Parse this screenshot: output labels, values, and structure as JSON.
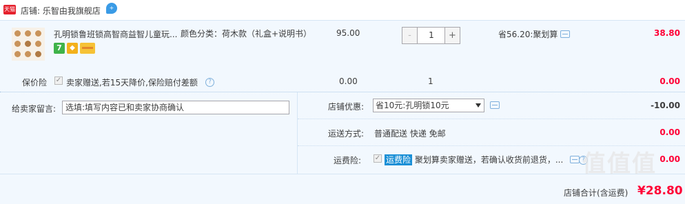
{
  "shop": {
    "badge": "天猫",
    "name": "店铺: 乐智由我旗舰店",
    "bubble": "+"
  },
  "product": {
    "title": "孔明锁鲁班锁高智商益智儿童玩...",
    "spec": "颜色分类：荷木款（礼盒+说明书）",
    "price": "95.00",
    "quantity": "1",
    "qty_minus": "-",
    "qty_plus": "+",
    "discount": "省56.20:聚划算",
    "subtotal": "38.80",
    "service_icons": [
      "seven-day-return-icon",
      "gift-icon",
      "card-icon"
    ],
    "service_seven_text": "7"
  },
  "insurance": {
    "label": "保价险",
    "checked": true,
    "text": "卖家赠送,若15天降价,保险赔付差额",
    "help": "?",
    "price": "0.00",
    "quantity": "1",
    "amount": "0.00"
  },
  "message": {
    "label": "给卖家留言:",
    "placeholder": "选填:填写内容已和卖家协商确认"
  },
  "shop_discount": {
    "label": "店铺优惠:",
    "selected": "省10元:孔明锁10元",
    "amount": "-10.00"
  },
  "shipping": {
    "label": "运送方式:",
    "value": "普通配送 快递 免邮",
    "amount": "0.00"
  },
  "freight_insurance": {
    "label": "运费险:",
    "checked": true,
    "tag": "运费险",
    "text": "聚划算卖家赠送，若确认收货前退货，...",
    "amount": "0.00"
  },
  "total": {
    "label": "店铺合计(含运费)",
    "value": "¥28.80"
  },
  "watermark": "值值值",
  "colors": {
    "accent_red": "#ff0036",
    "tmall_red": "#e5212d",
    "link_blue": "#1a8fd6",
    "panel_bg": "#f2f8fe"
  }
}
